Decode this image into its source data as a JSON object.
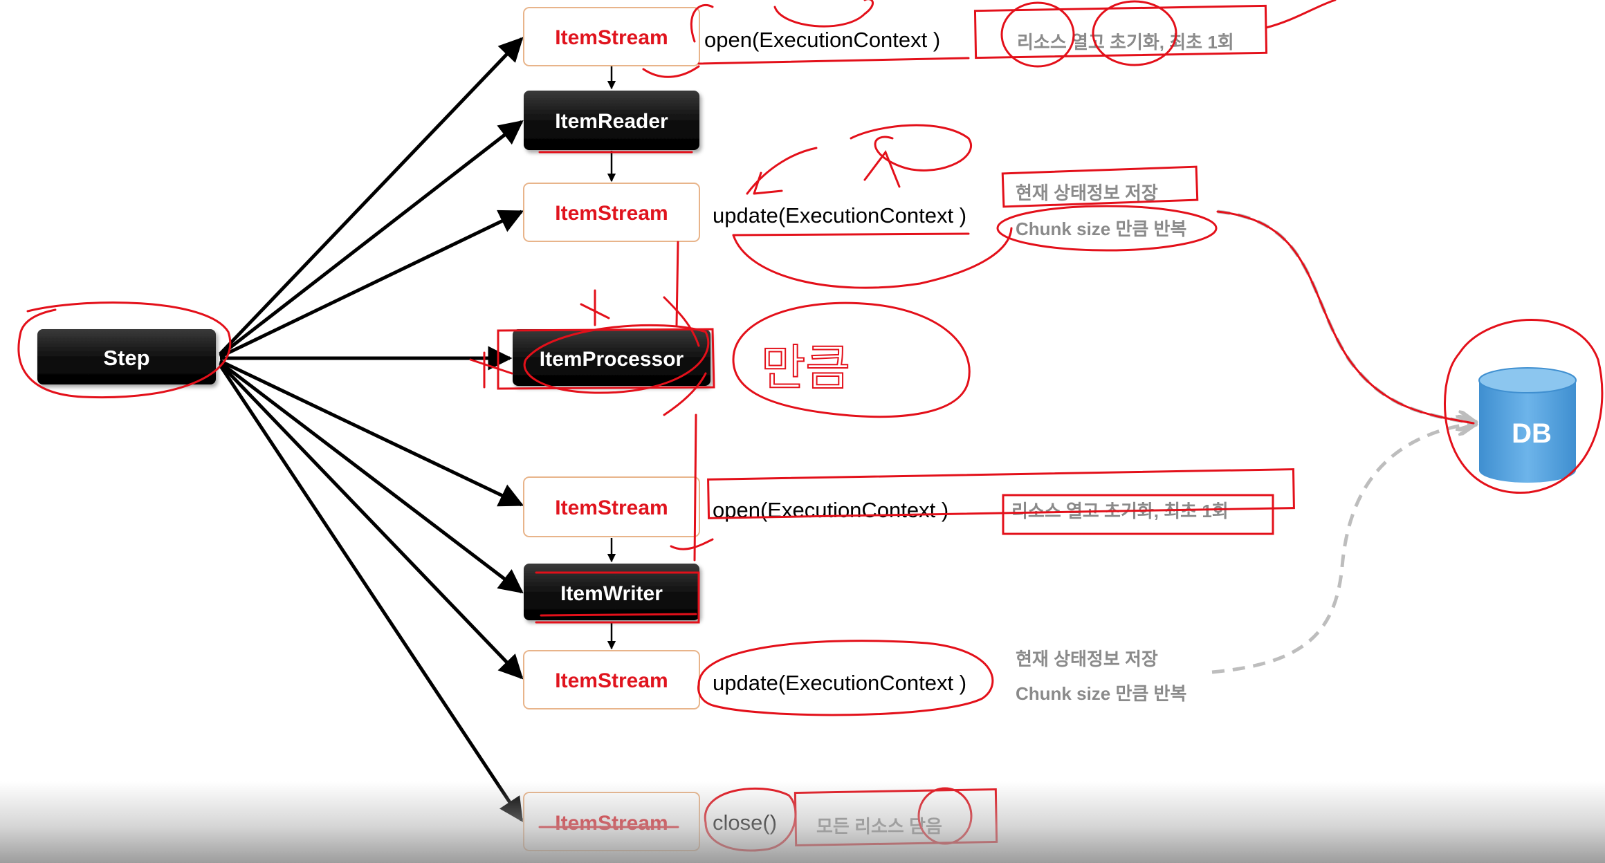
{
  "nodes": {
    "step": "Step",
    "item_reader": "ItemReader",
    "item_processor": "ItemProcessor",
    "item_writer": "ItemWriter",
    "item_stream": "ItemStream",
    "db": "DB"
  },
  "methods": {
    "open": "open(ExecutionContext )",
    "update": "update(ExecutionContext )",
    "close": "close()"
  },
  "notes": {
    "open_note": "리소스 열고 초기화, 최초 1회",
    "update_note_1": "현재 상태정보 저장",
    "update_note_2": "Chunk size 만큼 반복",
    "close_note": "모든 리소스 닫음"
  },
  "handwriting": {
    "processor_note": "만큼"
  },
  "colors": {
    "stream_text": "#e0141e",
    "stream_border": "#e8b48a",
    "node_fill": "#000000",
    "node_text": "#ffffff",
    "note_text": "#8a8a8a",
    "annotation": "#e3101a",
    "db_fill": "#4a9ad6",
    "connector": "#000000",
    "dashed": "#bdbdbd"
  }
}
